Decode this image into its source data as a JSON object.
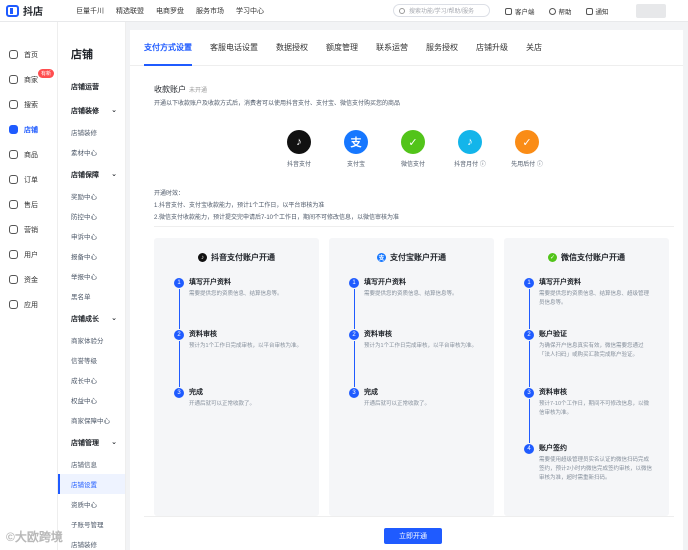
{
  "app": {
    "name": "抖店"
  },
  "topnav": [
    "巨量千川",
    "精选联盟",
    "电商罗盘",
    "服务市场",
    "学习中心"
  ],
  "search": {
    "placeholder": "搜索功能/学习/帮助/服务"
  },
  "topright": {
    "service": "客户端",
    "help": "帮助",
    "notice": "通知"
  },
  "nav": [
    {
      "label": "首页",
      "icon": "home-icon"
    },
    {
      "label": "商家",
      "icon": "shop-icon",
      "badge": "有新"
    },
    {
      "label": "搜索",
      "icon": "search-icon"
    },
    {
      "label": "店铺",
      "icon": "store-icon"
    },
    {
      "label": "商品",
      "icon": "goods-icon"
    },
    {
      "label": "订单",
      "icon": "order-icon"
    },
    {
      "label": "售后",
      "icon": "aftersale-icon"
    },
    {
      "label": "营销",
      "icon": "marketing-icon"
    },
    {
      "label": "用户",
      "icon": "user-icon"
    },
    {
      "label": "资金",
      "icon": "money-icon"
    },
    {
      "label": "应用",
      "icon": "app-icon"
    }
  ],
  "subnav": {
    "title": "店铺",
    "groups": [
      {
        "label": "店铺运营",
        "items": []
      },
      {
        "label": "店铺装修",
        "items": [
          "店铺装修",
          "素材中心"
        ]
      },
      {
        "label": "店铺保障",
        "items": [
          "奖励中心",
          "防控中心",
          "申诉中心",
          "报备中心",
          "举报中心",
          "黑名单"
        ]
      },
      {
        "label": "店铺成长",
        "items": [
          "商家体验分",
          "信誉等级",
          "成长中心",
          "权益中心",
          "商家保障中心"
        ]
      },
      {
        "label": "店铺管理",
        "items": [
          "店铺信息",
          "店铺设置",
          "资质中心",
          "子账号管理",
          "店铺装修"
        ]
      }
    ]
  },
  "tabs": [
    "支付方式设置",
    "客服电话设置",
    "数据授权",
    "额度管理",
    "联系运营",
    "服务授权",
    "店铺升级",
    "关店"
  ],
  "section": {
    "title": "收款账户",
    "status": "未开通",
    "desc": "开通以下收款账户及收款方式后，消费者可以使用抖音支付、支付宝、微信支付购买您的商品"
  },
  "pay_methods": [
    {
      "label": "抖音支付",
      "color": "#111111",
      "glyph": "♪"
    },
    {
      "label": "支付宝",
      "color": "#1677ff",
      "glyph": "支"
    },
    {
      "label": "微信支付",
      "color": "#52c41a",
      "glyph": "✓"
    },
    {
      "label": "抖音月付 ⓘ",
      "color": "#13b5ea",
      "glyph": "♪"
    },
    {
      "label": "先用后付 ⓘ",
      "color": "#fa8c16",
      "glyph": "✓"
    }
  ],
  "notes": {
    "title": "开通时效：",
    "line1": "1.抖音支付、支付宝收款能力，预计1个工作日，以平台审核为准",
    "line2": "2.微信支付收款能力，预计提交完申请后7-10个工作日，期间不可修改信息，以微信审核为准"
  },
  "cards": [
    {
      "title": "抖音支付账户开通",
      "color": "#111111",
      "glyph": "♪",
      "steps": [
        {
          "n": "1",
          "title": "填写开户资料",
          "desc": "需要提供您的资质信息、结算信息等。"
        },
        {
          "n": "2",
          "title": "资料审核",
          "desc": "预计为1个工作日完成审核，以平台审核为准。"
        },
        {
          "n": "3",
          "title": "完成",
          "desc": "开通后就可以正常收款了。"
        }
      ]
    },
    {
      "title": "支付宝账户开通",
      "color": "#1677ff",
      "glyph": "支",
      "steps": [
        {
          "n": "1",
          "title": "填写开户资料",
          "desc": "需要提供您的资质信息、结算信息等。"
        },
        {
          "n": "2",
          "title": "资料审核",
          "desc": "预计为1个工作日完成审核，以平台审核为准。"
        },
        {
          "n": "3",
          "title": "完成",
          "desc": "开通后就可以正常收款了。"
        }
      ]
    },
    {
      "title": "微信支付账户开通",
      "color": "#52c41a",
      "glyph": "✓",
      "steps": [
        {
          "n": "1",
          "title": "填写开户资料",
          "desc": "需要提供您的资质信息、结算信息、超级管理员信息等。"
        },
        {
          "n": "2",
          "title": "账户验证",
          "desc": "为确保开户信息真实有效，微信需要您通过「法人扫码」或购买汇款完成账户验证。"
        },
        {
          "n": "3",
          "title": "资料审核",
          "desc": "预计7-10个工作日，期间不可修改信息，以微信审核为准。"
        },
        {
          "n": "4",
          "title": "账户签约",
          "desc": "需要使用超级管理员实名认证的微信扫码完成签约，预计2小时内微信完成签约审核，以微信审核为准，超时需重新扫码。"
        }
      ]
    }
  ],
  "open_button": "立即开通",
  "watermark": "©大欧跨境"
}
